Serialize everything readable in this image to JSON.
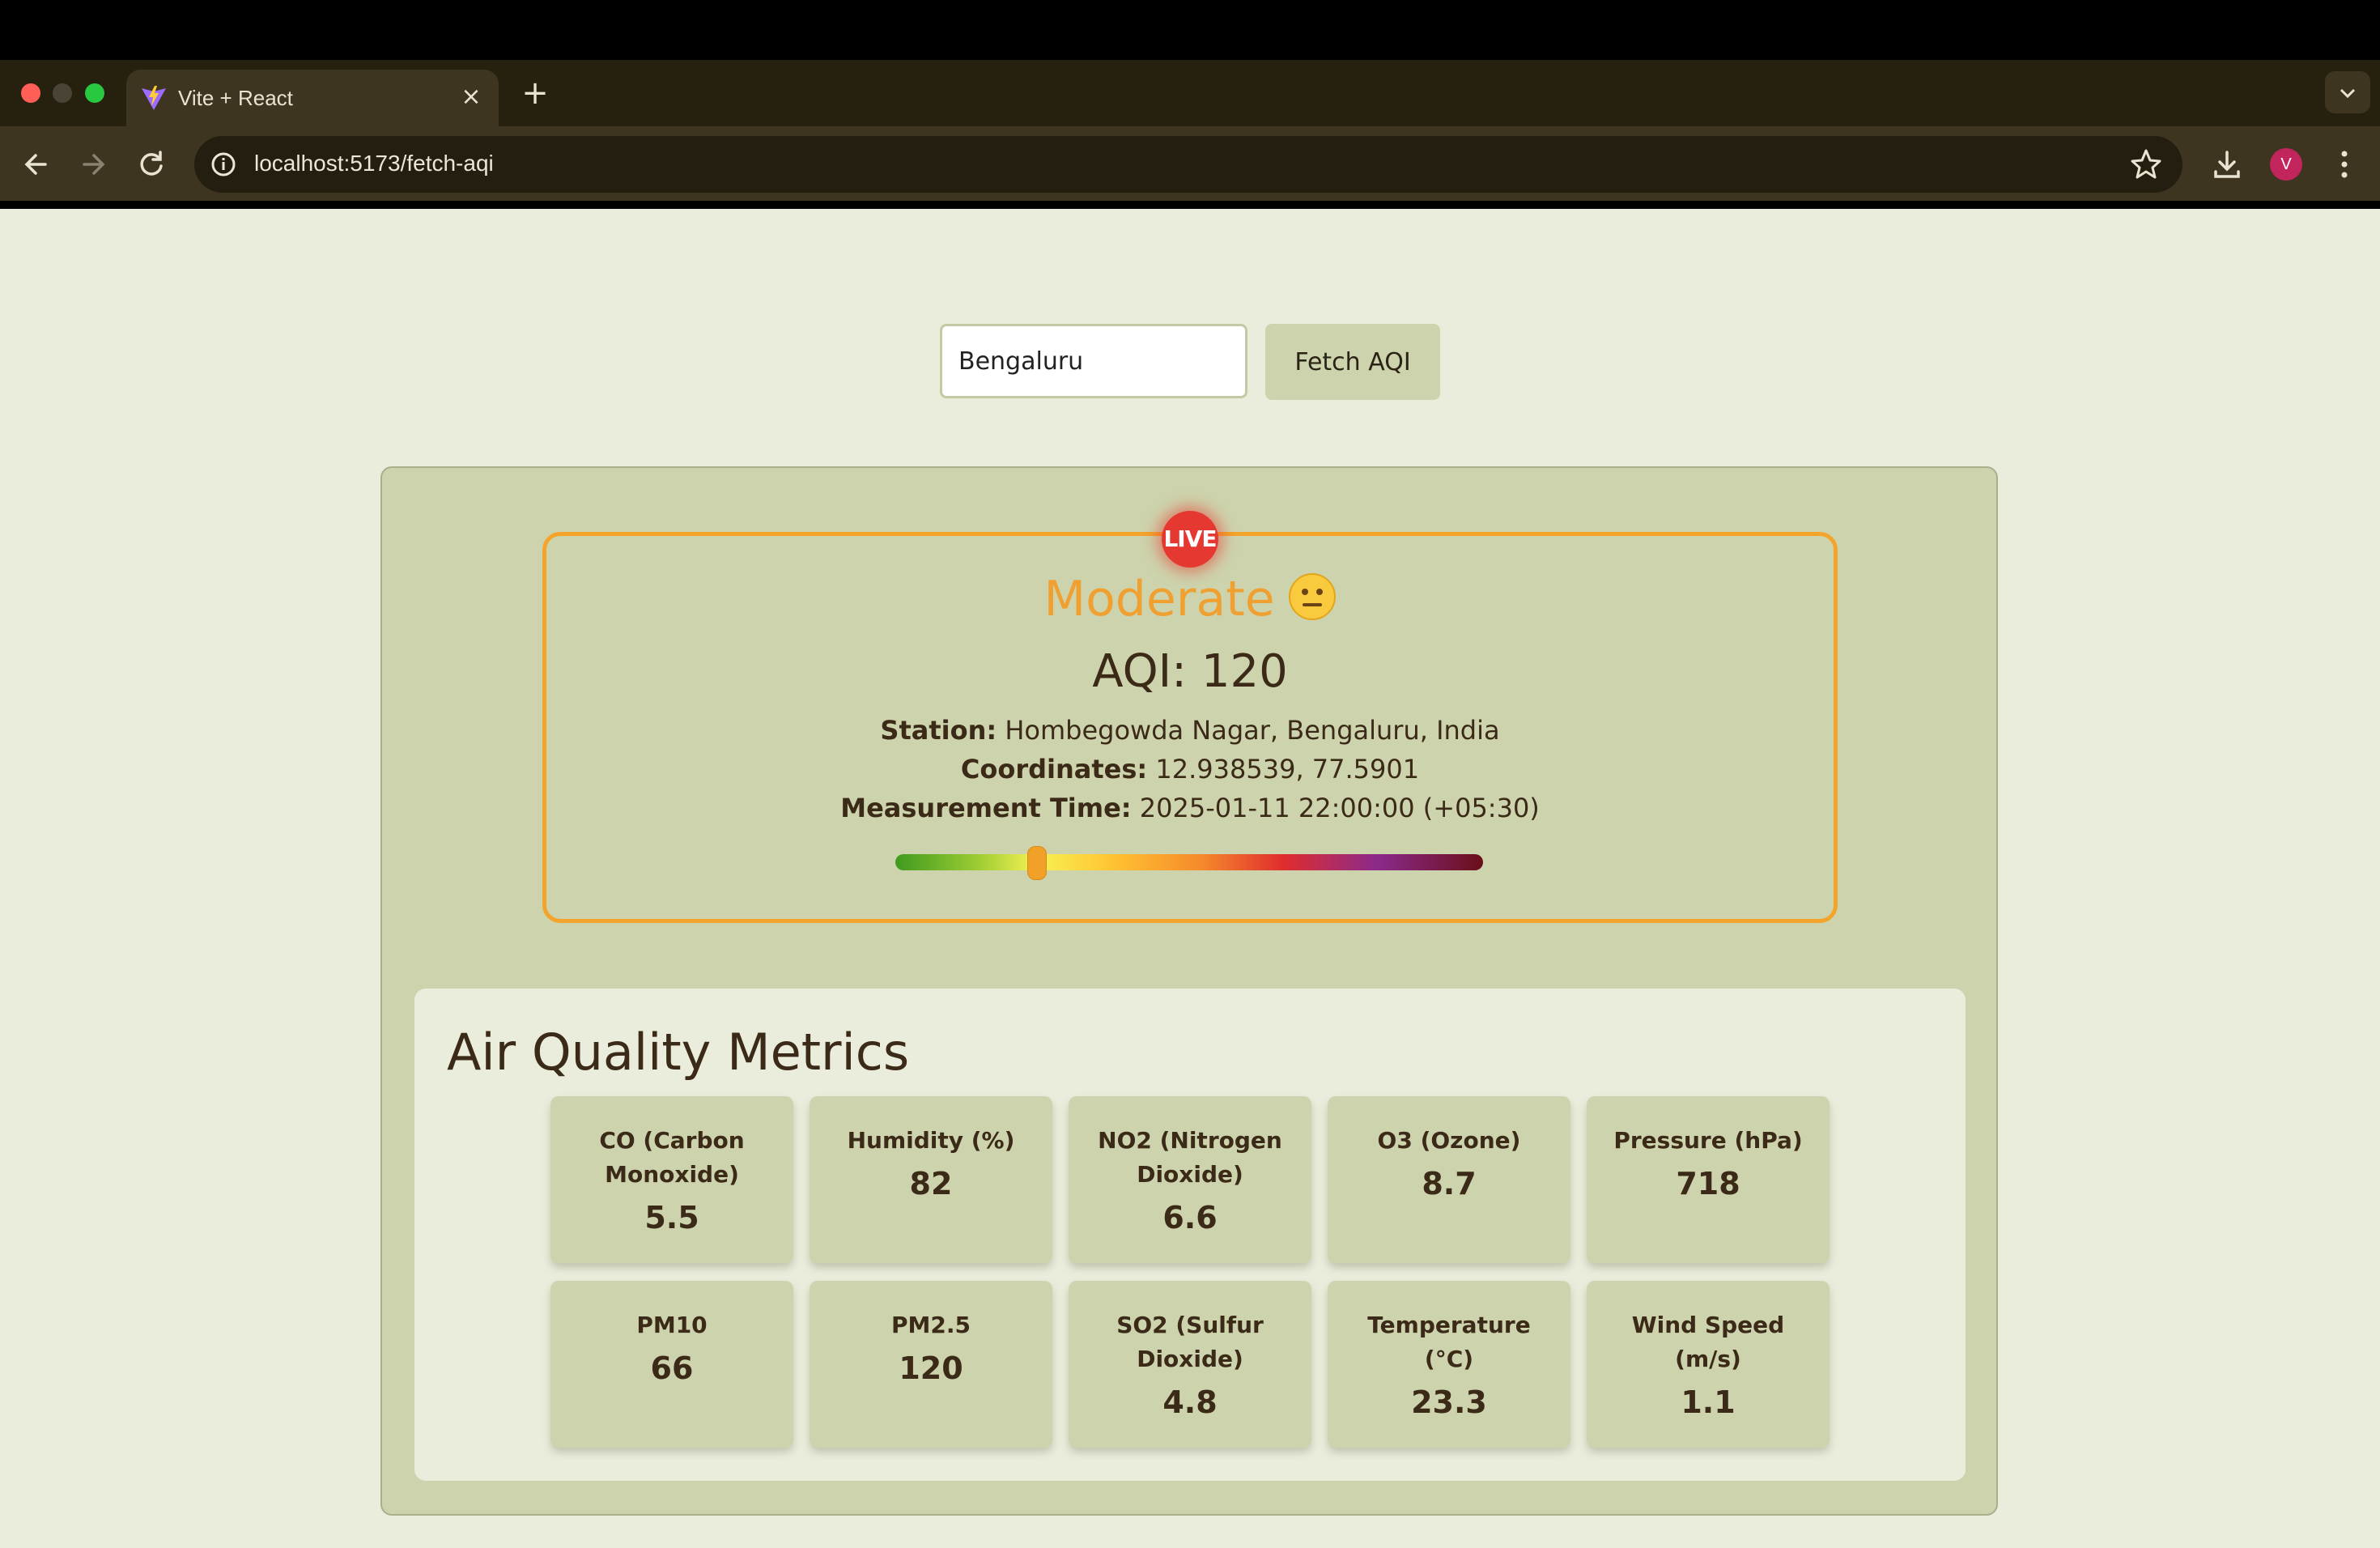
{
  "browser": {
    "tab_title": "Vite + React",
    "new_tab_symbol": "+",
    "url": "localhost:5173/fetch-aqi",
    "avatar_letter": "V"
  },
  "search": {
    "value": "Bengaluru",
    "button_label": "Fetch AQI"
  },
  "aqi": {
    "live_label": "LIVE",
    "status": "Moderate",
    "status_emoji": "neutral-face",
    "aqi_text": "AQI: 120",
    "station_label": "Station:",
    "station_value": "Hombegowda Nagar, Bengaluru, India",
    "coords_label": "Coordinates:",
    "coords_value": "12.938539, 77.5901",
    "time_label": "Measurement Time:",
    "time_value": "2025-01-11 22:00:00 (+05:30)",
    "scale_fraction": 0.24,
    "status_color": "#f0a030"
  },
  "metrics": {
    "title": "Air Quality Metrics",
    "items": [
      {
        "label": "CO (Carbon Monoxide)",
        "value": "5.5"
      },
      {
        "label": "Humidity (%)",
        "value": "82"
      },
      {
        "label": "NO2 (Nitrogen Dioxide)",
        "value": "6.6"
      },
      {
        "label": "O3 (Ozone)",
        "value": "8.7"
      },
      {
        "label": "Pressure (hPa)",
        "value": "718"
      },
      {
        "label": "PM10",
        "value": "66"
      },
      {
        "label": "PM2.5",
        "value": "120"
      },
      {
        "label": "SO2 (Sulfur Dioxide)",
        "value": "4.8"
      },
      {
        "label": "Temperature (°C)",
        "value": "23.3"
      },
      {
        "label": "Wind Speed (m/s)",
        "value": "1.1"
      }
    ]
  }
}
